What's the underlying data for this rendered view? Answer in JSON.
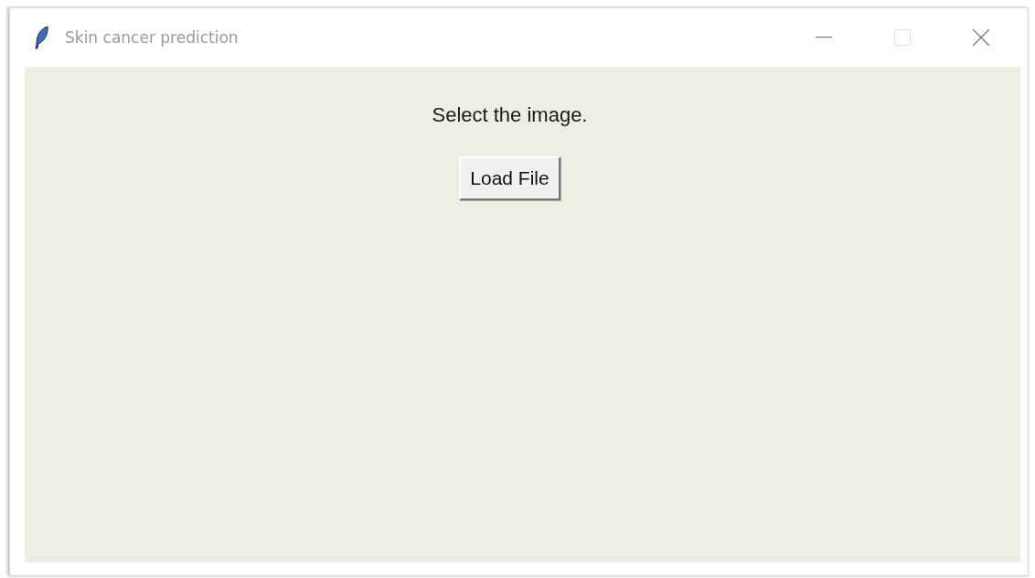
{
  "window": {
    "title": "Skin cancer prediction"
  },
  "content": {
    "label": "Select the image.",
    "button": "Load File"
  }
}
